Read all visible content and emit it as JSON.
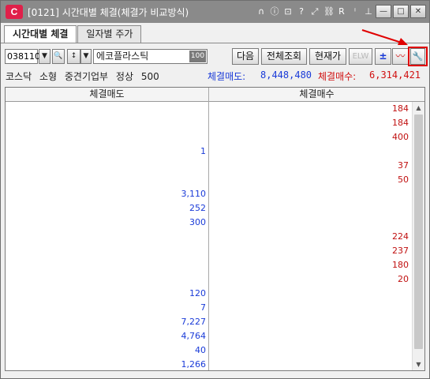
{
  "window": {
    "logo": "C",
    "title": "[0121] 시간대별 체결(체결가 비교방식)",
    "title_icons": [
      "headset-icon",
      "info-icon",
      "chat-icon",
      "help-icon",
      "expand-icon",
      "link-icon",
      "r-icon",
      "font-size-icon",
      "pin-icon"
    ],
    "title_icon_glyphs": [
      "∩",
      "ⓘ",
      "⊡",
      "?",
      "⤢",
      "⛓",
      "R",
      "ⁱ",
      "⊥"
    ],
    "btn_minimize": "—",
    "btn_maximize": "□",
    "btn_close": "✕"
  },
  "tabs": [
    {
      "label": "시간대별 체결",
      "active": true
    },
    {
      "label": "일자별 주가",
      "active": false
    }
  ],
  "toolbar": {
    "stock_code": "038110",
    "dropdown_glyph": "▼",
    "search_glyph": "🔍",
    "sort_glyph": "↕",
    "stock_name": "에코플라스틱",
    "stock_badge": "100",
    "next_label": "다음",
    "query_all_label": "전체조회",
    "current_price_label": "현재가",
    "elw_label": "ELW",
    "plus_minus_glyph": "±",
    "chart_glyph": "〰",
    "settings_glyph": "🔧"
  },
  "info": {
    "market": "코스닥",
    "size": "소형",
    "category": "중견기업부",
    "status": "정상",
    "unit": "500",
    "sell_label": "체결매도:",
    "sell_total": "8,448,480",
    "buy_label": "체결매수:",
    "buy_total": "6,314,421"
  },
  "grid": {
    "col_sell": "체결매도",
    "col_buy": "체결매수",
    "rows": [
      {
        "sell": "",
        "buy": "184"
      },
      {
        "sell": "",
        "buy": "184"
      },
      {
        "sell": "",
        "buy": "400"
      },
      {
        "sell": "1",
        "buy": ""
      },
      {
        "sell": "",
        "buy": "37"
      },
      {
        "sell": "",
        "buy": "50"
      },
      {
        "sell": "3,110",
        "buy": ""
      },
      {
        "sell": "252",
        "buy": ""
      },
      {
        "sell": "300",
        "buy": ""
      },
      {
        "sell": "",
        "buy": "224"
      },
      {
        "sell": "",
        "buy": "237"
      },
      {
        "sell": "",
        "buy": "180"
      },
      {
        "sell": "",
        "buy": "20"
      },
      {
        "sell": "120",
        "buy": ""
      },
      {
        "sell": "7",
        "buy": ""
      },
      {
        "sell": "7,227",
        "buy": ""
      },
      {
        "sell": "4,764",
        "buy": ""
      },
      {
        "sell": "40",
        "buy": ""
      },
      {
        "sell": "1,266",
        "buy": ""
      }
    ]
  },
  "scrollbar": {
    "up_glyph": "▲",
    "down_glyph": "▼"
  },
  "colors": {
    "sell": "#1a3bd8",
    "buy": "#d01010",
    "highlight": "#e00000",
    "logo": "#e0204a"
  }
}
